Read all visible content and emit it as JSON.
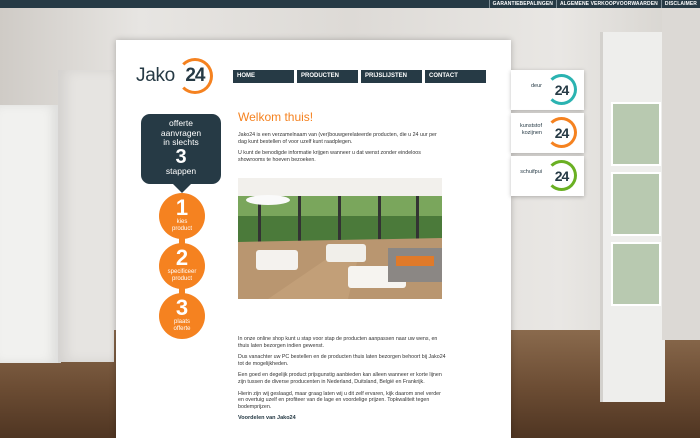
{
  "top_links": [
    "GARANTIEBEPALINGEN",
    "ALGEMENE VERKOOPVOORWAARDEN",
    "DISCLAIMER"
  ],
  "logo": {
    "word": "Jako",
    "number": "24"
  },
  "nav": [
    "HOME",
    "PRODUCTEN",
    "PRIJSLIJSTEN",
    "CONTACT"
  ],
  "promo": {
    "line1": "offerte",
    "line2": "aanvragen",
    "line3": "in slechts",
    "big": "3",
    "line4": "stappen"
  },
  "steps": [
    {
      "num": "1",
      "line1": "kies",
      "line2": "product"
    },
    {
      "num": "2",
      "line1": "specificeer",
      "line2": "product"
    },
    {
      "num": "3",
      "line1": "plaats",
      "line2": "offerte"
    }
  ],
  "content": {
    "heading": "Welkom thuis!",
    "intro1": "Jako24 is een verzamelnaam van (ver)bouwgerelateerde producten, die u 24 uur per dag kunt bestellen of voor uzelf kunt raadplegen.",
    "intro2": "U kunt de benodigde informatie krijgen wanneer u dat wenst zonder eindeloos showrooms te hoeven bezoeken.",
    "para1": "In onze online shop kunt u stap voor stap de producten aanpassen naar uw wens, en thuis laten bezorgen indien gewenst.",
    "para2": "Dus vanachter uw PC bestellen en de producten thuis laten bezorgen behoort bij Jako24 tot de mogelijkheden.",
    "para3": "Een goed en degelijk product prijsgunstig aanbieden kan alleen wanneer er korte lijnen zijn tussen de diverse producenten in Nederland, Duitsland, België en Frankrijk.",
    "para4": "Hierin zijn wij geslaagd, maar graag laten wij u dit zelf ervaren, kijk daarom snel verder en overtuig uzelf en profiteer van de lage en voordelige prijzen. Topkwaliteit tegen bodemprijzen.",
    "subhead": "Voordelen van Jako24"
  },
  "brand_tabs": [
    {
      "label1": "deur",
      "label2": "",
      "number": "24",
      "color": "#2bb3b1"
    },
    {
      "label1": "kunststof",
      "label2": "kozijnen",
      "number": "24",
      "color": "#f58220"
    },
    {
      "label1": "schuifpui",
      "label2": "",
      "number": "24",
      "color": "#6ab023"
    }
  ],
  "colors": {
    "navy": "#263a45",
    "orange": "#f58220"
  }
}
